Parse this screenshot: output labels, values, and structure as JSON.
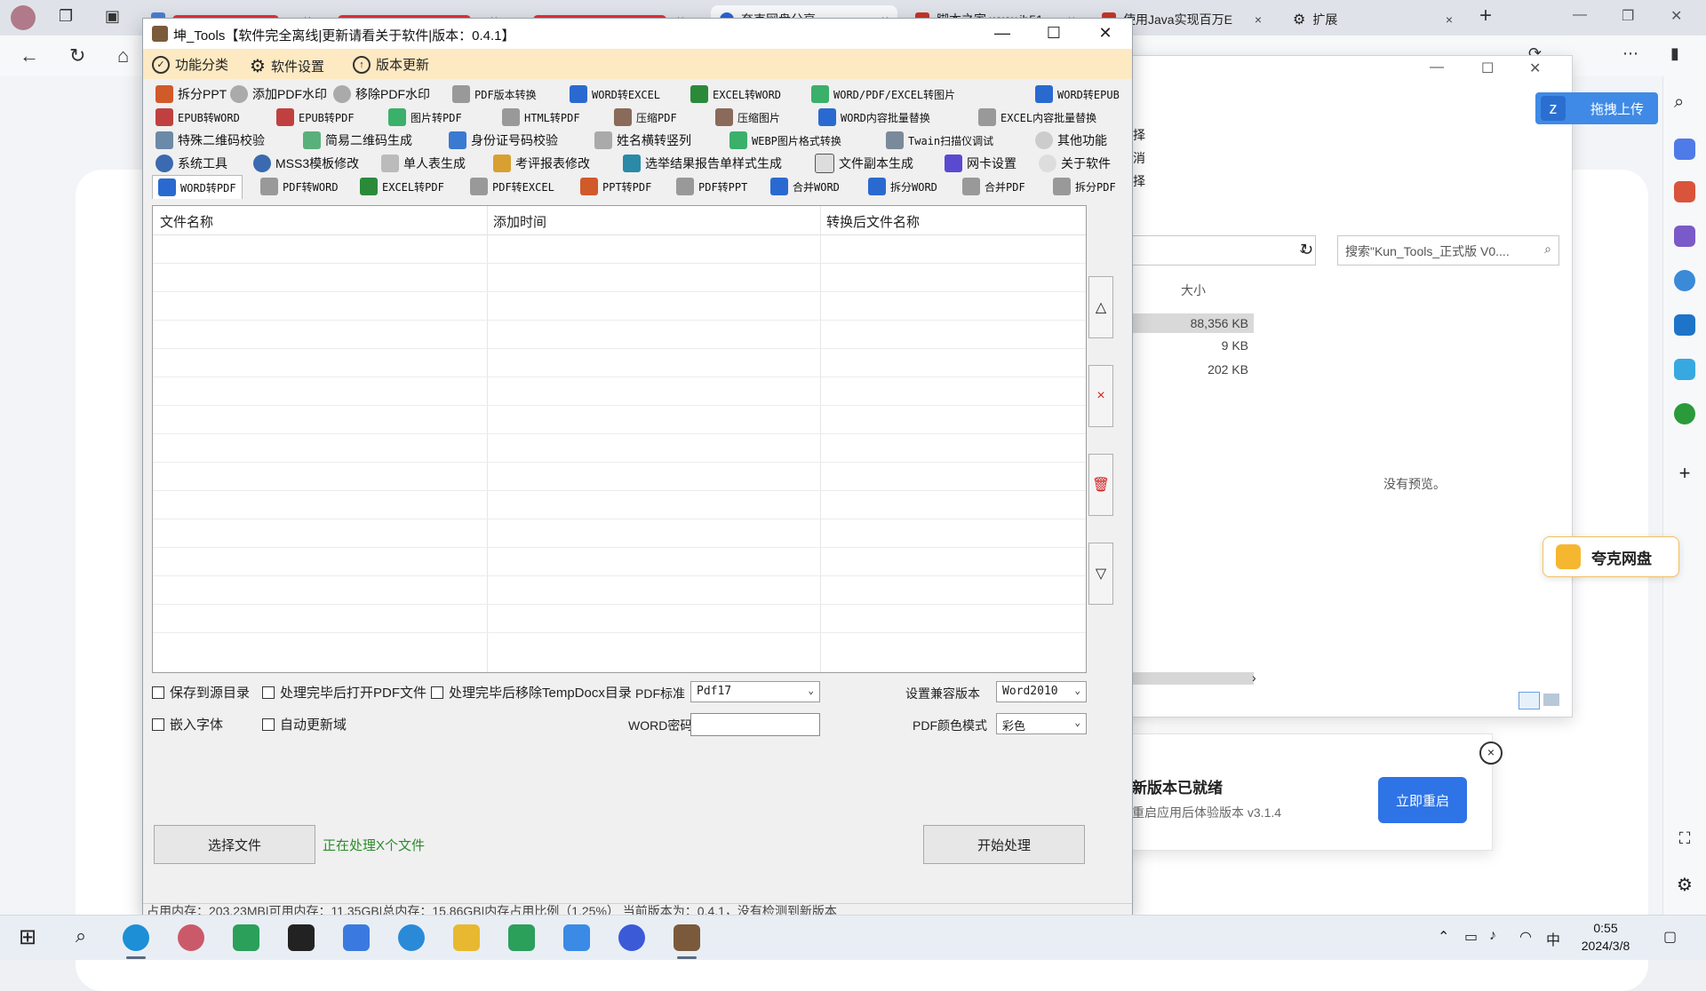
{
  "browser": {
    "tabs": [
      {
        "label": "",
        "scribbled": true
      },
      {
        "label": "",
        "scribbled": true
      },
      {
        "label": "夸克网盘分享",
        "scribbled": false
      },
      {
        "label": "脚本之家 www.jb51",
        "scribbled": false
      },
      {
        "label": "使用Java实现百万E",
        "scribbled": false
      },
      {
        "label": "扩展",
        "scribbled": false
      }
    ],
    "new_tab": "+",
    "upload_button": "拖拽上传",
    "quark_pan": "夸克网盘"
  },
  "explorer": {
    "search_placeholder": "搜索\"Kun_Tools_正式版 V0....",
    "size_header": "大小",
    "sizes": [
      "88,356 KB",
      "9 KB",
      "202 KB"
    ],
    "no_preview": "没有预览。",
    "side_chars": [
      "择",
      "消",
      "择"
    ]
  },
  "update_card": {
    "title": "新版本已就绪",
    "subtitle": "重启应用后体验版本 v3.1.4",
    "restart_button": "立即重启"
  },
  "app": {
    "title": "坤_Tools【软件完全离线|更新请看关于软件|版本：0.4.1】",
    "menu": [
      "功能分类",
      "软件设置",
      "版本更新"
    ],
    "toolbar_rows": [
      [
        "拆分PPT",
        "添加PDF水印",
        "移除PDF水印",
        "PDF版本转换",
        "WORD转EXCEL",
        "EXCEL转WORD",
        "WORD/PDF/EXCEL转图片",
        "WORD转EPUB"
      ],
      [
        "EPUB转WORD",
        "EPUB转PDF",
        "图片转PDF",
        "HTML转PDF",
        "压缩PDF",
        "压缩图片",
        "WORD内容批量替换",
        "EXCEL内容批量替换"
      ],
      [
        "特殊二维码校验",
        "简易二维码生成",
        "身份证号码校验",
        "姓名横转竖列",
        "WEBP图片格式转换",
        "Twain扫描仪调试",
        "其他功能"
      ],
      [
        "系统工具",
        "MSS3模板修改",
        "单人表生成",
        "考评报表修改",
        "选举结果报告单样式生成",
        "文件副本生成",
        "网卡设置",
        "关于软件"
      ],
      [
        "WORD转PDF",
        "PDF转WORD",
        "EXCEL转PDF",
        "PDF转EXCEL",
        "PPT转PDF",
        "PDF转PPT",
        "合并WORD",
        "拆分WORD",
        "合并PDF",
        "拆分PDF"
      ]
    ],
    "table": {
      "columns": [
        "文件名称",
        "添加时间",
        "转换后文件名称"
      ],
      "rows": []
    },
    "side_buttons": [
      "△",
      "×",
      "🗑",
      "▽"
    ],
    "options": {
      "save_to_source": "保存到源目录",
      "open_after": "处理完毕后打开PDF文件",
      "remove_temp": "处理完毕后移除TempDocx目录",
      "embed_fonts": "嵌入字体",
      "auto_update_fields": "自动更新域",
      "pdf_standard_label": "PDF标准",
      "pdf_standard_value": "Pdf17",
      "compat_label": "设置兼容版本",
      "compat_value": "Word2010",
      "word_password_label": "WORD密码",
      "word_password_value": "",
      "pdf_color_label": "PDF颜色模式",
      "pdf_color_value": "彩色"
    },
    "select_file_button": "选择文件",
    "processing_status": "正在处理X个文件",
    "start_button": "开始处理",
    "statusbar": "占用内存：203.23MB|可用内存：11.35GB|总内存：15.86GB|内存占用比例（1.25%）    当前版本为：0.4.1，没有检测到新版本"
  },
  "taskbar": {
    "time": "0:55",
    "date": "2024/3/8",
    "ime": "中"
  },
  "colors": {
    "menubar": "#fde9c2",
    "accent_blue": "#2e74e6",
    "status_green": "#2e8b2e"
  }
}
